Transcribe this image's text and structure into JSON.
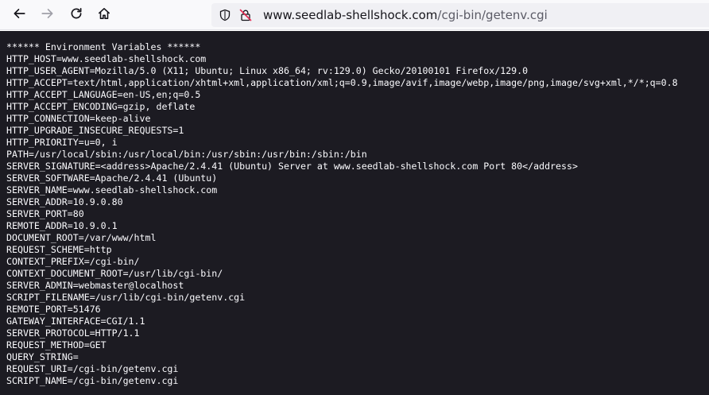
{
  "browser": {
    "url_scheme": "",
    "url_host": "www.seedlab-shellshock.com",
    "url_path": "/cgi-bin/getenv.cgi"
  },
  "page": {
    "lines": [
      "****** Environment Variables ******",
      "HTTP_HOST=www.seedlab-shellshock.com",
      "HTTP_USER_AGENT=Mozilla/5.0 (X11; Ubuntu; Linux x86_64; rv:129.0) Gecko/20100101 Firefox/129.0",
      "HTTP_ACCEPT=text/html,application/xhtml+xml,application/xml;q=0.9,image/avif,image/webp,image/png,image/svg+xml,*/*;q=0.8",
      "HTTP_ACCEPT_LANGUAGE=en-US,en;q=0.5",
      "HTTP_ACCEPT_ENCODING=gzip, deflate",
      "HTTP_CONNECTION=keep-alive",
      "HTTP_UPGRADE_INSECURE_REQUESTS=1",
      "HTTP_PRIORITY=u=0, i",
      "PATH=/usr/local/sbin:/usr/local/bin:/usr/sbin:/usr/bin:/sbin:/bin",
      "SERVER_SIGNATURE=<address>Apache/2.4.41 (Ubuntu) Server at www.seedlab-shellshock.com Port 80</address>",
      "SERVER_SOFTWARE=Apache/2.4.41 (Ubuntu)",
      "SERVER_NAME=www.seedlab-shellshock.com",
      "SERVER_ADDR=10.9.0.80",
      "SERVER_PORT=80",
      "REMOTE_ADDR=10.9.0.1",
      "DOCUMENT_ROOT=/var/www/html",
      "REQUEST_SCHEME=http",
      "CONTEXT_PREFIX=/cgi-bin/",
      "CONTEXT_DOCUMENT_ROOT=/usr/lib/cgi-bin/",
      "SERVER_ADMIN=webmaster@localhost",
      "SCRIPT_FILENAME=/usr/lib/cgi-bin/getenv.cgi",
      "REMOTE_PORT=51476",
      "GATEWAY_INTERFACE=CGI/1.1",
      "SERVER_PROTOCOL=HTTP/1.1",
      "REQUEST_METHOD=GET",
      "QUERY_STRING=",
      "REQUEST_URI=/cgi-bin/getenv.cgi",
      "SCRIPT_NAME=/cgi-bin/getenv.cgi"
    ]
  },
  "icons": {
    "back": "arrow-left-icon",
    "forward": "arrow-right-icon",
    "reload": "reload-icon",
    "home": "home-icon",
    "tracking": "shield-icon",
    "security": "insecure-lock-icon"
  },
  "colors": {
    "toolbar_bg": "#f9f9fb",
    "urlbar_bg": "#f0f0f4",
    "page_bg": "#1c1b22",
    "page_text": "#fbfbfe",
    "insecure_red": "#e22850"
  }
}
